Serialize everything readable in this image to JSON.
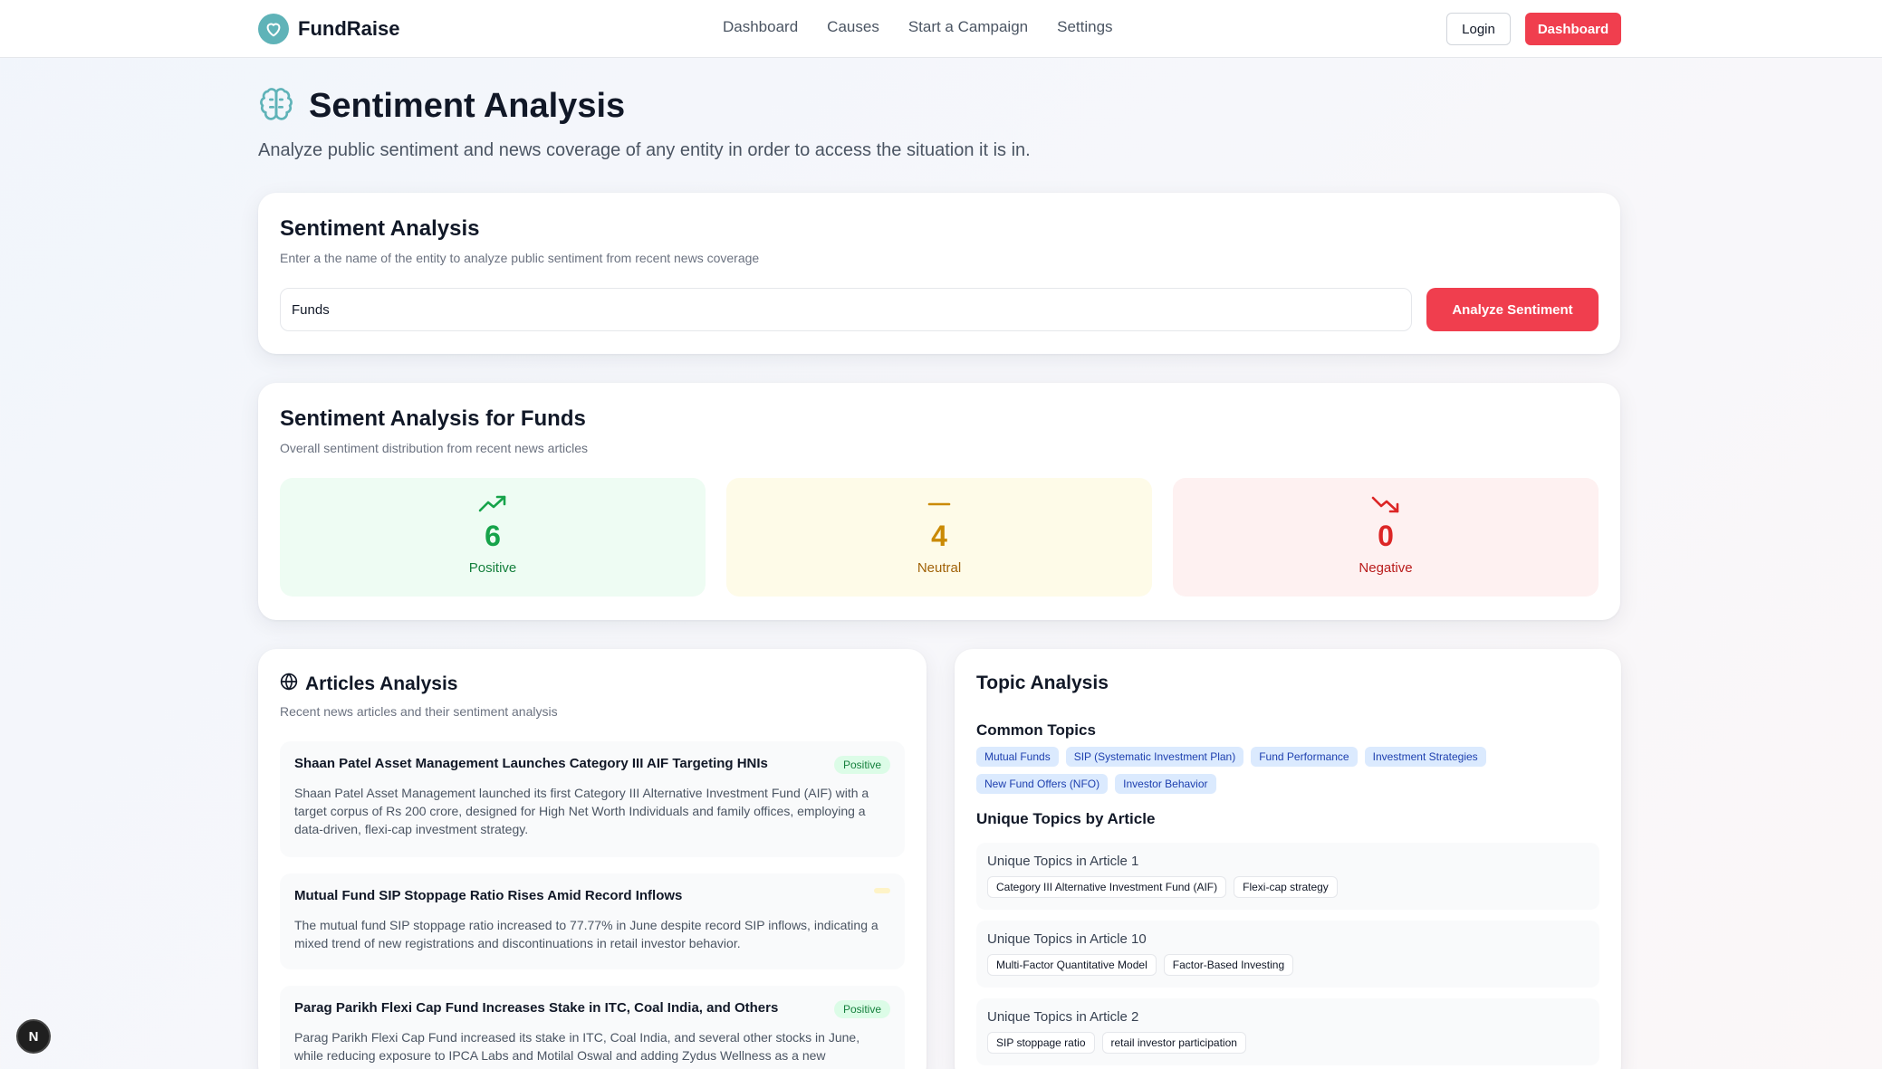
{
  "brand": {
    "name": "FundRaise"
  },
  "nav": [
    "Dashboard",
    "Causes",
    "Start a Campaign",
    "Settings"
  ],
  "header_buttons": {
    "login": "Login",
    "dashboard": "Dashboard"
  },
  "page": {
    "title": "Sentiment Analysis",
    "subtitle": "Analyze public sentiment and news coverage of any entity in order to access the situation it is in."
  },
  "search_card": {
    "title": "Sentiment Analysis",
    "description": "Enter a the name of the entity to analyze public sentiment from recent news coverage",
    "input_value": "Funds",
    "button": "Analyze Sentiment"
  },
  "results_card": {
    "title": "Sentiment Analysis for Funds",
    "description": "Overall sentiment distribution from recent news articles",
    "stats": [
      {
        "value": "6",
        "label": "Positive",
        "icon": "trending-up-icon",
        "color": "#16a34a"
      },
      {
        "value": "4",
        "label": "Neutral",
        "icon": "minus-icon",
        "color": "#ca8a04"
      },
      {
        "value": "0",
        "label": "Negative",
        "icon": "trending-down-icon",
        "color": "#dc2626"
      }
    ]
  },
  "articles_card": {
    "title": "Articles Analysis",
    "description": "Recent news articles and their sentiment analysis",
    "articles": [
      {
        "title": "Shaan Patel Asset Management Launches Category III AIF Targeting HNIs",
        "sentiment": "Positive",
        "summary": "Shaan Patel Asset Management launched its first Category III Alternative Investment Fund (AIF) with a target corpus of Rs 200 crore, designed for High Net Worth Individuals and family offices, employing a data-driven, flexi-cap investment strategy."
      },
      {
        "title": "Mutual Fund SIP Stoppage Ratio Rises Amid Record Inflows",
        "sentiment": "",
        "summary": "The mutual fund SIP stoppage ratio increased to 77.77% in June despite record SIP inflows, indicating a mixed trend of new registrations and discontinuations in retail investor behavior."
      },
      {
        "title": "Parag Parikh Flexi Cap Fund Increases Stake in ITC, Coal India, and Others",
        "sentiment": "Positive",
        "summary": "Parag Parikh Flexi Cap Fund increased its stake in ITC, Coal India, and several other stocks in June, while reducing exposure to IPCA Labs and Motilal Oswal and adding Zydus Wellness as a new"
      }
    ]
  },
  "topics_card": {
    "title": "Topic Analysis",
    "common_heading": "Common Topics",
    "common_topics": [
      "Mutual Funds",
      "SIP (Systematic Investment Plan)",
      "Fund Performance",
      "Investment Strategies",
      "New Fund Offers (NFO)",
      "Investor Behavior"
    ],
    "unique_heading": "Unique Topics by Article",
    "unique": [
      {
        "title": "Unique Topics in Article 1",
        "topics": [
          "Category III Alternative Investment Fund (AIF)",
          "Flexi-cap strategy"
        ]
      },
      {
        "title": "Unique Topics in Article 10",
        "topics": [
          "Multi-Factor Quantitative Model",
          "Factor-Based Investing"
        ]
      },
      {
        "title": "Unique Topics in Article 2",
        "topics": [
          "SIP stoppage ratio",
          "retail investor participation"
        ]
      }
    ]
  },
  "dev_badge": "N"
}
